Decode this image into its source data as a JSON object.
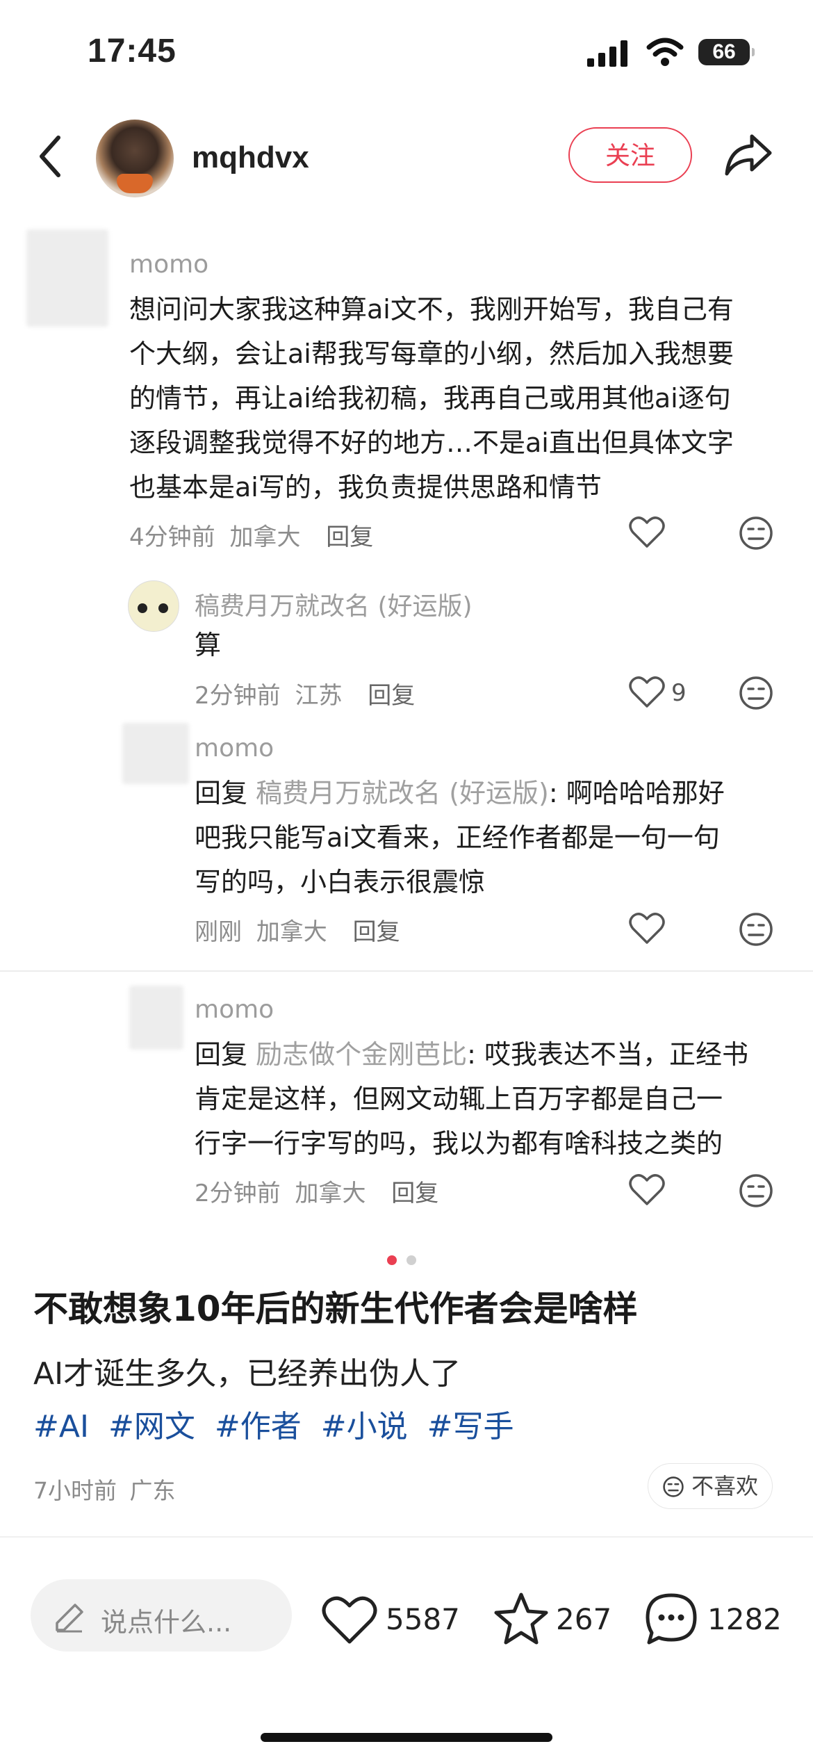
{
  "status_bar": {
    "time": "17:45",
    "battery": "66"
  },
  "header": {
    "username": "mqhdvx",
    "follow_label": "关注"
  },
  "comments": {
    "c1": {
      "name": "momo",
      "lines": [
        "想问问大家我这种算ai文不，我刚开始写，我自己有",
        "个大纲，会让ai帮我写每章的小纲，然后加入我想要",
        "的情节，再让ai给我初稿，我再自己或用其他ai逐句",
        "逐段调整我觉得不好的地方…不是ai直出但具体文字",
        "也基本是ai写的，我负责提供思路和情节"
      ],
      "time": "4分钟前",
      "location": "加拿大",
      "reply": "回复"
    },
    "c2": {
      "name": "稿费月万就改名 (好运版)",
      "text": "算",
      "time": "2分钟前",
      "location": "江苏",
      "reply": "回复",
      "likes": "9"
    },
    "c3": {
      "name": "momo",
      "reply_prefix": "回复",
      "reply_to": "稿费月万就改名 (好运版)",
      "line1": ": 啊哈哈哈那好",
      "lines": [
        "吧我只能写ai文看来，正经作者都是一句一句",
        "写的吗，小白表示很震惊"
      ],
      "time": "刚刚",
      "location": "加拿大",
      "reply": "回复"
    },
    "c4": {
      "name": "momo",
      "reply_prefix": "回复",
      "reply_to": "励志做个金刚芭比",
      "line1": ": 哎我表达不当，正经书",
      "lines": [
        "肯定是这样，但网文动辄上百万字都是自己一",
        "行字一行字写的吗，我以为都有啥科技之类的"
      ],
      "time": "2分钟前",
      "location": "加拿大",
      "reply": "回复"
    }
  },
  "post": {
    "title": "不敢想象10年后的新生代作者会是啥样",
    "subtitle": "AI才诞生多久，已经养出伪人了",
    "tags": [
      "#AI",
      "#网文",
      "#作者",
      "#小说",
      "#写手"
    ],
    "time": "7小时前",
    "location": "广东",
    "dislike_label": "不喜欢"
  },
  "bottom_bar": {
    "input_placeholder": "说点什么...",
    "likes": "5587",
    "stars": "267",
    "comments": "1282"
  },
  "colors": {
    "accent_red": "#ea3f52",
    "tag_blue": "#1a4f9c"
  }
}
